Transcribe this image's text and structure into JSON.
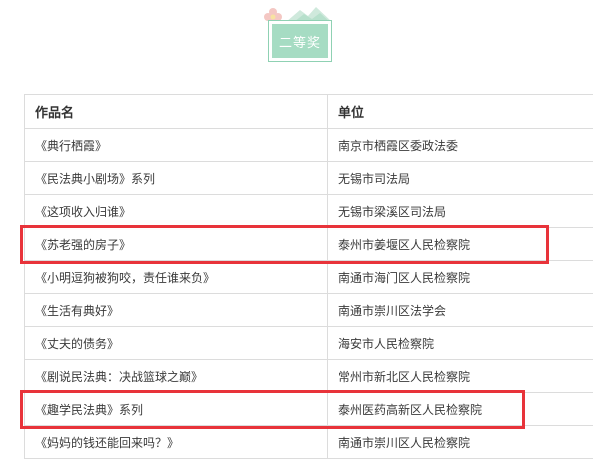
{
  "badge": {
    "label": "二等奖"
  },
  "table": {
    "headers": [
      "作品名",
      "单位"
    ],
    "rows": [
      {
        "work": "《典行栖霞》",
        "unit": "南京市栖霞区委政法委",
        "highlighted": false
      },
      {
        "work": "《民法典小剧场》系列",
        "unit": "无锡市司法局",
        "highlighted": false
      },
      {
        "work": "《这项收入归谁》",
        "unit": "无锡市梁溪区司法局",
        "highlighted": false
      },
      {
        "work": "《苏老强的房子》",
        "unit": "泰州市姜堰区人民检察院",
        "highlighted": true
      },
      {
        "work": "《小明逗狗被狗咬，责任谁来负》",
        "unit": "南通市海门区人民检察院",
        "highlighted": false
      },
      {
        "work": "《生活有典好》",
        "unit": "南通市崇川区法学会",
        "highlighted": false
      },
      {
        "work": "《丈夫的债务》",
        "unit": "海安市人民检察院",
        "highlighted": false
      },
      {
        "work": "《剧说民法典：决战篮球之巅》",
        "unit": "常州市新北区人民检察院",
        "highlighted": false
      },
      {
        "work": "《趣学民法典》系列",
        "unit": "泰州医药高新区人民检察院",
        "highlighted": true
      },
      {
        "work": "《妈妈的钱还能回来吗？》",
        "unit": "南通市崇川区人民检察院",
        "highlighted": false
      }
    ]
  },
  "colors": {
    "badge_fill": "#a6dcc3",
    "badge_border": "#8fd1b3",
    "highlight": "#e8333a",
    "grid": "#dcdcdc"
  }
}
